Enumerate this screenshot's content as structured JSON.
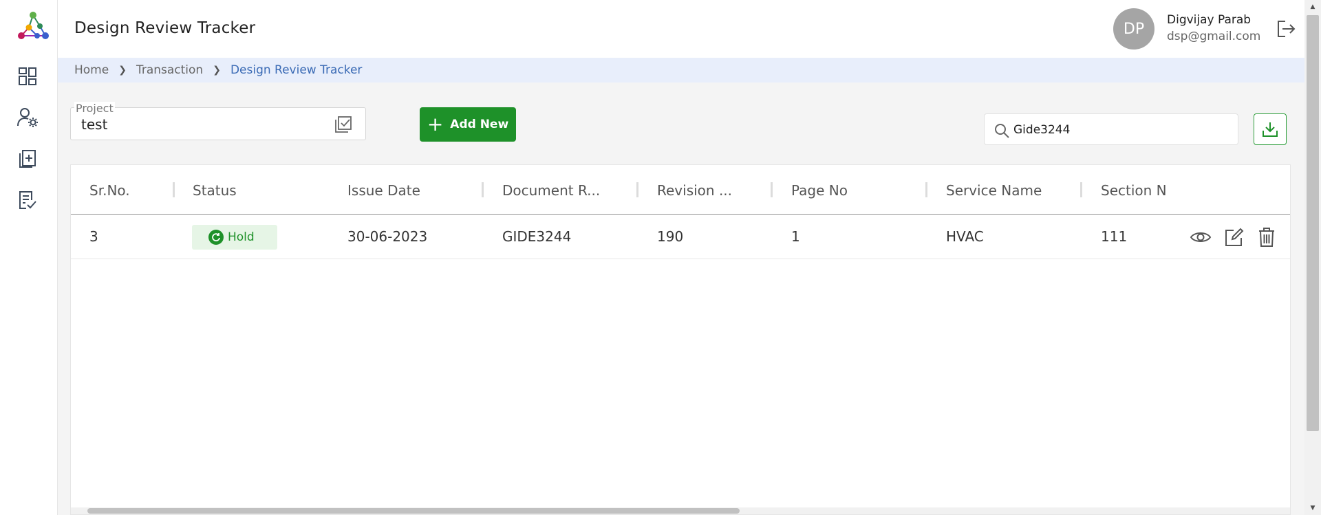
{
  "header": {
    "title": "Design Review Tracker",
    "user": {
      "initials": "DP",
      "name": "Digvijay Parab",
      "email": "dsp@gmail.com"
    }
  },
  "breadcrumb": [
    "Home",
    "Transaction",
    "Design Review Tracker"
  ],
  "toolbar": {
    "project_label": "Project",
    "project_value": "test",
    "add_new_label": "Add New",
    "search_value": "Gide3244"
  },
  "table": {
    "columns": [
      "Sr.No.",
      "Status",
      "Issue Date",
      "Document R...",
      "Revision ...",
      "Page No",
      "Service Name",
      "Section N"
    ],
    "rows": [
      {
        "sr_no": "3",
        "status": "Hold",
        "issue_date": "30-06-2023",
        "document_ref": "GIDE3244",
        "revision": "190",
        "page_no": "1",
        "service_name": "HVAC",
        "section_no": "111"
      }
    ]
  },
  "colors": {
    "accent_green": "#1e9129",
    "breadcrumb_bg": "#e8eefb",
    "breadcrumb_active": "#3b6bb5",
    "avatar_bg": "#a5a5a5"
  },
  "icons": [
    "app-logo",
    "dashboard-icon",
    "user-settings-icon",
    "document-add-icon",
    "document-check-icon",
    "logout-icon",
    "checklist-icon",
    "search-icon",
    "download-icon",
    "view-icon",
    "edit-icon",
    "delete-icon",
    "hold-status-icon"
  ]
}
